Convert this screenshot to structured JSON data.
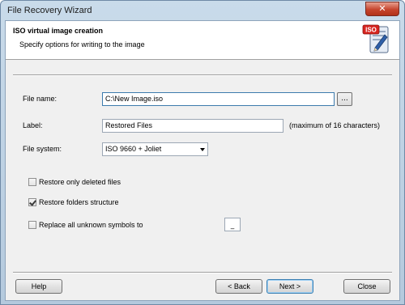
{
  "window": {
    "title": "File Recovery Wizard",
    "close_glyph": "✕"
  },
  "header": {
    "title": "ISO virtual image creation",
    "subtitle": "Specify options for writing to the image",
    "icon_text": "ISO",
    "icon": "iso-image-icon"
  },
  "form": {
    "file_name": {
      "label": "File name:",
      "value": "C:\\New Image.iso",
      "browse_label": "..."
    },
    "label_field": {
      "label": "Label:",
      "value": "Restored Files",
      "hint": "(maximum of 16 characters)"
    },
    "file_system": {
      "label": "File system:",
      "selected": "ISO 9660 + Joliet"
    }
  },
  "options": [
    {
      "label": "Restore only deleted files",
      "checked": false
    },
    {
      "label": "Restore folders structure",
      "checked": true
    },
    {
      "label": "Replace all unknown symbols to",
      "checked": false,
      "replace_char": "_"
    }
  ],
  "buttons": {
    "help": "Help",
    "back": "< Back",
    "next": "Next >",
    "close": "Close"
  },
  "colors": {
    "title_bar": "#b4c9dd",
    "client_bg": "#f0f0f0",
    "close_button": "#c6452d",
    "default_button_border": "#3c7fb1"
  }
}
